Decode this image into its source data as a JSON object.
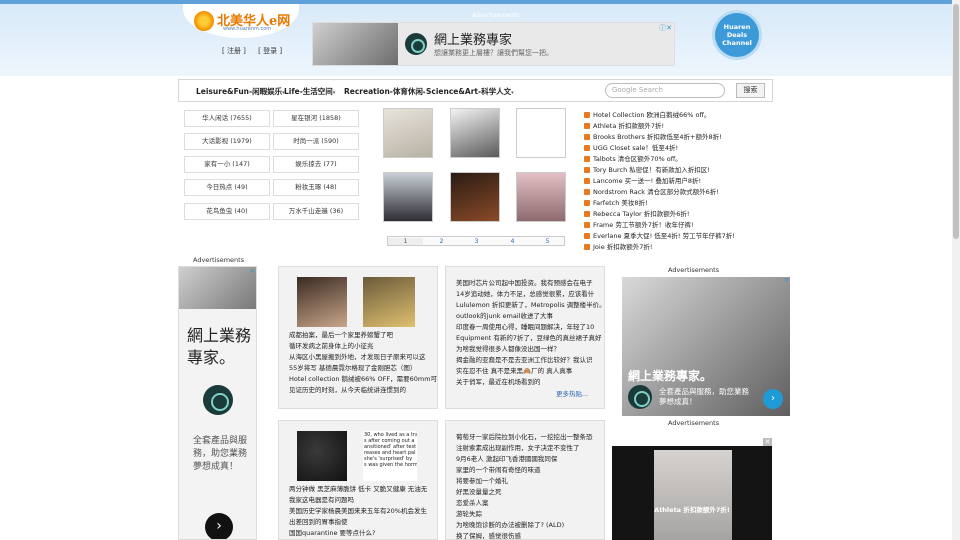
{
  "header": {
    "logo_text": "北美华人e网",
    "logo_sub": "www.huarenm.com",
    "login_label": "[ 注册 ]",
    "register_label": "[ 登录 ]",
    "deals_badge": [
      "Huaren",
      "Deals",
      "Channel"
    ]
  },
  "top_ad": {
    "label": "Advertisements",
    "title": "網上業務專家",
    "subtitle": "想讓業務更上層樓？讓我們幫您一把。",
    "close": "ⓘ✕"
  },
  "nav": {
    "items": [
      "Leisure&Fun-闲暇娱乐",
      "Life-生活空间",
      "Recreation-体育休闲",
      "Science&Art-科学人文"
    ],
    "search_placeholder": "Google Search",
    "search_button": "搜索"
  },
  "categories": [
    "华人闲话 (7655)",
    "星在银河 (1858)",
    "大话影视 (1979)",
    "时尚一派 (590)",
    "家有一小 (147)",
    "娱乐掠去 (77)",
    "今日热点 (49)",
    "粉妆玉琢 (48)",
    "花鸟鱼虫 (40)",
    "万水千山走遍 (36)"
  ],
  "pagination": [
    "1",
    "2",
    "3",
    "4",
    "5"
  ],
  "deals": [
    "Hotel Collection 欧洲白鹅绒66% off。",
    "Athleta 折扣款额外7折!",
    "Brooks Brothers 折扣款低至4折+额外8折!",
    "UGG Closet sale！低至4折!",
    "Talbots 清仓区额外70% off。",
    "Tory Burch 私密促！有新款加入折扣区!",
    "Lancome 买一送一! 叠加新用户8折!",
    "Nordstrom Rack 清仓区部分款式额外6折!",
    "Farfetch 美妆8折!",
    "Rebecca Taylor 折扣款额外6折!",
    "Frame 劳工节额外7折！收年仔裤!",
    "Everlane 夏季大促! 低至4折! 劳工节年仔裤7折!",
    "Joie 折扣款额外7折!"
  ],
  "ads": {
    "left_label": "Advertisements",
    "left_title": "網上業務專家。",
    "left_desc": "全套產品與服務，助您業務夢想成真！",
    "right_label": "Advertisements",
    "right_title": "網上業務專家。",
    "right_desc": "全套產品與服務，助您業務夢想成真！",
    "right_label2": "Advertisements",
    "bottom_caption": "Athleta 折扣款额外7折!"
  },
  "card1": {
    "lines": [
      "成都拍案，最后一个家里养螃蟹了吧",
      "循环发病之前身体上的小征兆",
      "从海区小黑屋搬到外地，才发现日子原来可以这",
      "55岁将写 基德晨霓尔格现了金刚胆芯（图）",
      "Hotel collection 鹅绒被66% OFF，需要60mm可",
      "见证历史的时刻，从今天临统讲连惯到的"
    ]
  },
  "card2": {
    "lines": [
      "美国时芯片公司起中国投资。我有预感会在电子",
      "14岁追动她，体力不足，总感觉很累，应该看什",
      "Lululemon 折扣更新了，Metropolis 调整楼半价。",
      "outlook的junk email收进了大事",
      "印度春一周使用心得，睡眠间题解决，年轻了10",
      "Equipment 有新的7折了，豆绿色的真丝裙子真好",
      "为啥我觉得很多人都像没出国一样？",
      "揭金融的亚裔是不是去亚洲工作比较好？我认识",
      "实在忍不住 真不是来黑🙈厂的 真人真事",
      "关于俏军，最近在机场看到的"
    ],
    "more": "更多热贴..."
  },
  "card3": {
    "lines": [
      "两分钟做 黑芝麻薄脆饼 低卡 又脆又健康 无油无",
      "我家这电器是有问题吗",
      "美国历史学家杨晨美国来来五年有20%机会发生",
      "出差回到的胃事指使",
      "国国quarantine 要等点什么?"
    ],
    "img_caption": [
      "30, who lived as a tra",
      "s after coming out a",
      "ansitioned' after test",
      "reases and heart pal",
      "she's 'surprised' by",
      "s was given the horm"
    ]
  },
  "card4": {
    "lines": [
      "葡萄牙一家后院拉到小化石，一挖挖出一整条恐",
      "注射索素成出现副作用，女子决定不变性了",
      "9月6老人 激起印飞香港國國我同保",
      "家里的一个带闹有奇怪的味道",
      "将要参加一个婚礼",
      "好黑没量量之死",
      "恋爱杀人案",
      "游轮失踪",
      "为啥晚饱诊断的办法被删除了? (ALD)",
      "换了保姆，感觉很伤感"
    ]
  }
}
